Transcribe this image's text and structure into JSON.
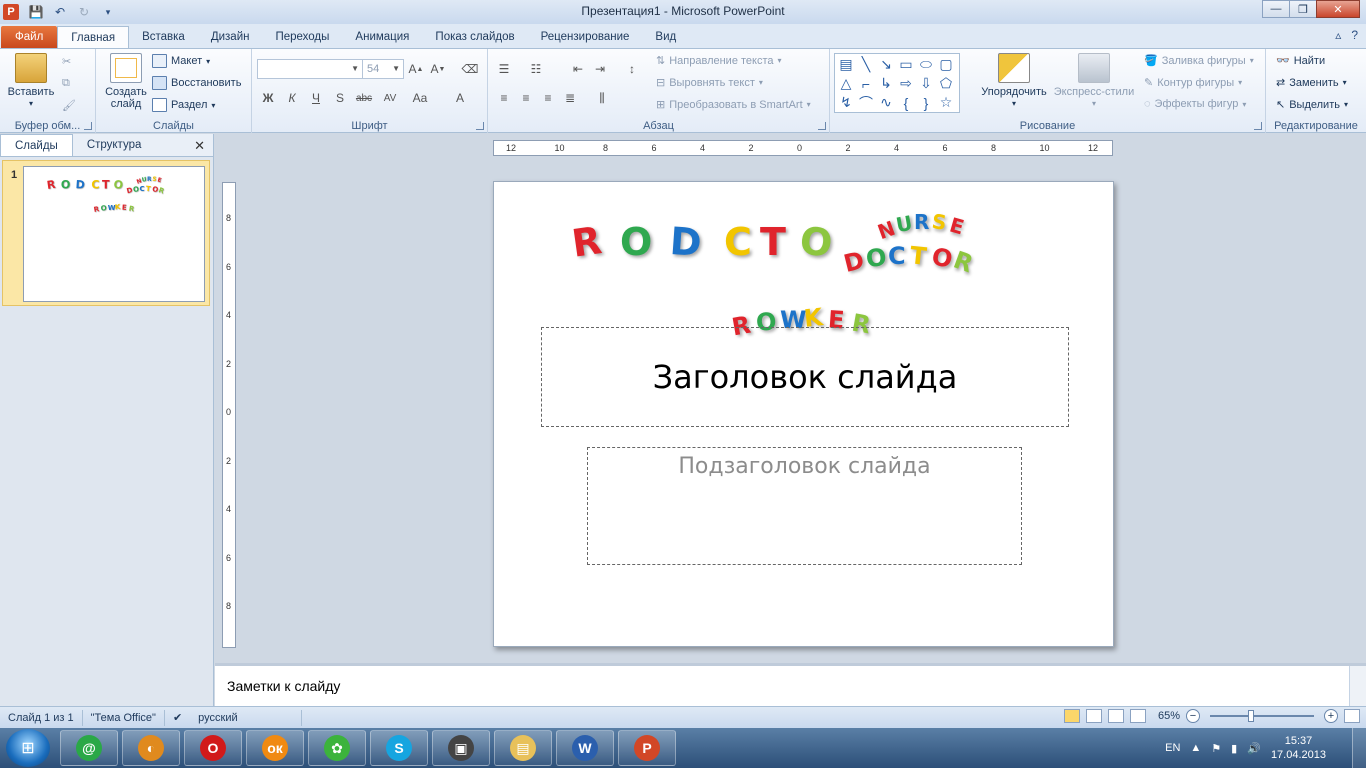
{
  "window": {
    "title": "Презентация1  -  Microsoft PowerPoint",
    "app_icon": "P",
    "controls": {
      "minimize": "—",
      "restore": "❐",
      "close": "✕"
    }
  },
  "tabs": [
    "Файл",
    "Главная",
    "Вставка",
    "Дизайн",
    "Переходы",
    "Анимация",
    "Показ слайдов",
    "Рецензирование",
    "Вид"
  ],
  "tabs_right": {
    "minimize_ribbon": "▵",
    "help": "?"
  },
  "ribbon": {
    "clipboard": {
      "label": "Буфер обм...",
      "paste": "Вставить"
    },
    "slides": {
      "label": "Слайды",
      "new_slide": "Создать слайд",
      "layout": "Макет",
      "reset": "Восстановить",
      "section": "Раздел"
    },
    "font": {
      "label": "Шрифт",
      "font_name": "",
      "font_size": "54"
    },
    "paragraph": {
      "label": "Абзац",
      "text_direction": "Направление текста",
      "align_text": "Выровнять текст",
      "smartart": "Преобразовать в SmartArt"
    },
    "drawing": {
      "label": "Рисование",
      "arrange": "Упорядочить",
      "quick_styles": "Экспресс-стили",
      "shape_fill": "Заливка фигуры",
      "shape_outline": "Контур фигуры",
      "shape_effects": "Эффекты фигур"
    },
    "editing": {
      "label": "Редактирование",
      "find": "Найти",
      "replace": "Заменить",
      "select": "Выделить"
    }
  },
  "left_pane": {
    "tabs": [
      "Слайды",
      "Структура"
    ],
    "close": "✕",
    "slide_number": "1"
  },
  "rulers": {
    "h_labels": [
      "12",
      "10",
      "8",
      "6",
      "4",
      "2",
      "0",
      "2",
      "4",
      "6",
      "8",
      "10",
      "12"
    ],
    "v_labels": [
      "8",
      "6",
      "4",
      "2",
      "0",
      "2",
      "4",
      "6",
      "8"
    ]
  },
  "slide": {
    "wordart_row1": [
      "R",
      "O",
      "D",
      "C",
      "T",
      "O"
    ],
    "wordart_arc1": [
      "N",
      "U",
      "R",
      "S",
      "E"
    ],
    "wordart_arc2": [
      "D",
      "O",
      "C",
      "T",
      "O",
      "R"
    ],
    "wordart_row2": [
      "R",
      "O",
      "W",
      "K",
      "E",
      "R"
    ],
    "title_placeholder": "Заголовок слайда",
    "subtitle_placeholder": "Подзаголовок слайда"
  },
  "notes": {
    "placeholder": "Заметки к слайду"
  },
  "status": {
    "slide_info": "Слайд 1 из 1",
    "theme": "\"Тема Office\"",
    "language": "русский",
    "zoom": "65%"
  },
  "taskbar": {
    "lang": "EN",
    "time": "15:37",
    "date": "17.04.2013",
    "apps": [
      {
        "name": "mail-agent",
        "glyph": "@",
        "color": "#2aa847"
      },
      {
        "name": "browser-ball",
        "glyph": "◐",
        "color": "#e08a1e"
      },
      {
        "name": "opera",
        "glyph": "O",
        "color": "#d11a1a"
      },
      {
        "name": "odnoklassniki",
        "glyph": "ок",
        "color": "#f08a12"
      },
      {
        "name": "icq",
        "glyph": "✿",
        "color": "#3cb33c"
      },
      {
        "name": "skype",
        "glyph": "S",
        "color": "#16a5e0"
      },
      {
        "name": "media",
        "glyph": "▣",
        "color": "#444444"
      },
      {
        "name": "explorer",
        "glyph": "▤",
        "color": "#e8c15a"
      },
      {
        "name": "word",
        "glyph": "W",
        "color": "#2b5fad"
      },
      {
        "name": "powerpoint",
        "glyph": "P",
        "color": "#d24726"
      }
    ]
  }
}
